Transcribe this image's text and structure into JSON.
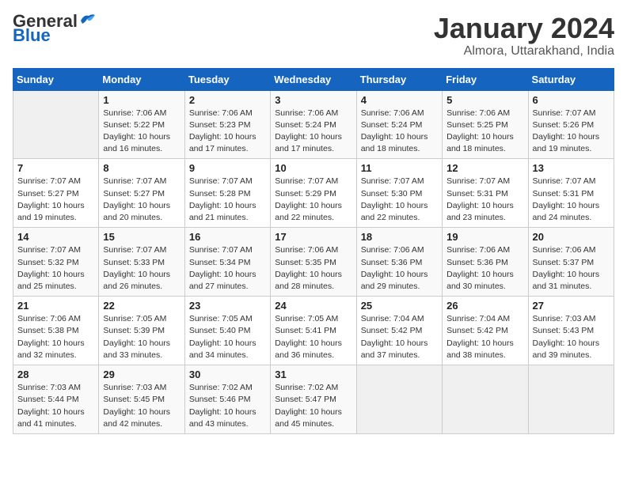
{
  "header": {
    "logo_general": "General",
    "logo_blue": "Blue",
    "title": "January 2024",
    "subtitle": "Almora, Uttarakhand, India"
  },
  "columns": [
    "Sunday",
    "Monday",
    "Tuesday",
    "Wednesday",
    "Thursday",
    "Friday",
    "Saturday"
  ],
  "weeks": [
    [
      {
        "num": "",
        "info": ""
      },
      {
        "num": "1",
        "info": "Sunrise: 7:06 AM\nSunset: 5:22 PM\nDaylight: 10 hours\nand 16 minutes."
      },
      {
        "num": "2",
        "info": "Sunrise: 7:06 AM\nSunset: 5:23 PM\nDaylight: 10 hours\nand 17 minutes."
      },
      {
        "num": "3",
        "info": "Sunrise: 7:06 AM\nSunset: 5:24 PM\nDaylight: 10 hours\nand 17 minutes."
      },
      {
        "num": "4",
        "info": "Sunrise: 7:06 AM\nSunset: 5:24 PM\nDaylight: 10 hours\nand 18 minutes."
      },
      {
        "num": "5",
        "info": "Sunrise: 7:06 AM\nSunset: 5:25 PM\nDaylight: 10 hours\nand 18 minutes."
      },
      {
        "num": "6",
        "info": "Sunrise: 7:07 AM\nSunset: 5:26 PM\nDaylight: 10 hours\nand 19 minutes."
      }
    ],
    [
      {
        "num": "7",
        "info": "Sunrise: 7:07 AM\nSunset: 5:27 PM\nDaylight: 10 hours\nand 19 minutes."
      },
      {
        "num": "8",
        "info": "Sunrise: 7:07 AM\nSunset: 5:27 PM\nDaylight: 10 hours\nand 20 minutes."
      },
      {
        "num": "9",
        "info": "Sunrise: 7:07 AM\nSunset: 5:28 PM\nDaylight: 10 hours\nand 21 minutes."
      },
      {
        "num": "10",
        "info": "Sunrise: 7:07 AM\nSunset: 5:29 PM\nDaylight: 10 hours\nand 22 minutes."
      },
      {
        "num": "11",
        "info": "Sunrise: 7:07 AM\nSunset: 5:30 PM\nDaylight: 10 hours\nand 22 minutes."
      },
      {
        "num": "12",
        "info": "Sunrise: 7:07 AM\nSunset: 5:31 PM\nDaylight: 10 hours\nand 23 minutes."
      },
      {
        "num": "13",
        "info": "Sunrise: 7:07 AM\nSunset: 5:31 PM\nDaylight: 10 hours\nand 24 minutes."
      }
    ],
    [
      {
        "num": "14",
        "info": "Sunrise: 7:07 AM\nSunset: 5:32 PM\nDaylight: 10 hours\nand 25 minutes."
      },
      {
        "num": "15",
        "info": "Sunrise: 7:07 AM\nSunset: 5:33 PM\nDaylight: 10 hours\nand 26 minutes."
      },
      {
        "num": "16",
        "info": "Sunrise: 7:07 AM\nSunset: 5:34 PM\nDaylight: 10 hours\nand 27 minutes."
      },
      {
        "num": "17",
        "info": "Sunrise: 7:06 AM\nSunset: 5:35 PM\nDaylight: 10 hours\nand 28 minutes."
      },
      {
        "num": "18",
        "info": "Sunrise: 7:06 AM\nSunset: 5:36 PM\nDaylight: 10 hours\nand 29 minutes."
      },
      {
        "num": "19",
        "info": "Sunrise: 7:06 AM\nSunset: 5:36 PM\nDaylight: 10 hours\nand 30 minutes."
      },
      {
        "num": "20",
        "info": "Sunrise: 7:06 AM\nSunset: 5:37 PM\nDaylight: 10 hours\nand 31 minutes."
      }
    ],
    [
      {
        "num": "21",
        "info": "Sunrise: 7:06 AM\nSunset: 5:38 PM\nDaylight: 10 hours\nand 32 minutes."
      },
      {
        "num": "22",
        "info": "Sunrise: 7:05 AM\nSunset: 5:39 PM\nDaylight: 10 hours\nand 33 minutes."
      },
      {
        "num": "23",
        "info": "Sunrise: 7:05 AM\nSunset: 5:40 PM\nDaylight: 10 hours\nand 34 minutes."
      },
      {
        "num": "24",
        "info": "Sunrise: 7:05 AM\nSunset: 5:41 PM\nDaylight: 10 hours\nand 36 minutes."
      },
      {
        "num": "25",
        "info": "Sunrise: 7:04 AM\nSunset: 5:42 PM\nDaylight: 10 hours\nand 37 minutes."
      },
      {
        "num": "26",
        "info": "Sunrise: 7:04 AM\nSunset: 5:42 PM\nDaylight: 10 hours\nand 38 minutes."
      },
      {
        "num": "27",
        "info": "Sunrise: 7:03 AM\nSunset: 5:43 PM\nDaylight: 10 hours\nand 39 minutes."
      }
    ],
    [
      {
        "num": "28",
        "info": "Sunrise: 7:03 AM\nSunset: 5:44 PM\nDaylight: 10 hours\nand 41 minutes."
      },
      {
        "num": "29",
        "info": "Sunrise: 7:03 AM\nSunset: 5:45 PM\nDaylight: 10 hours\nand 42 minutes."
      },
      {
        "num": "30",
        "info": "Sunrise: 7:02 AM\nSunset: 5:46 PM\nDaylight: 10 hours\nand 43 minutes."
      },
      {
        "num": "31",
        "info": "Sunrise: 7:02 AM\nSunset: 5:47 PM\nDaylight: 10 hours\nand 45 minutes."
      },
      {
        "num": "",
        "info": ""
      },
      {
        "num": "",
        "info": ""
      },
      {
        "num": "",
        "info": ""
      }
    ]
  ]
}
